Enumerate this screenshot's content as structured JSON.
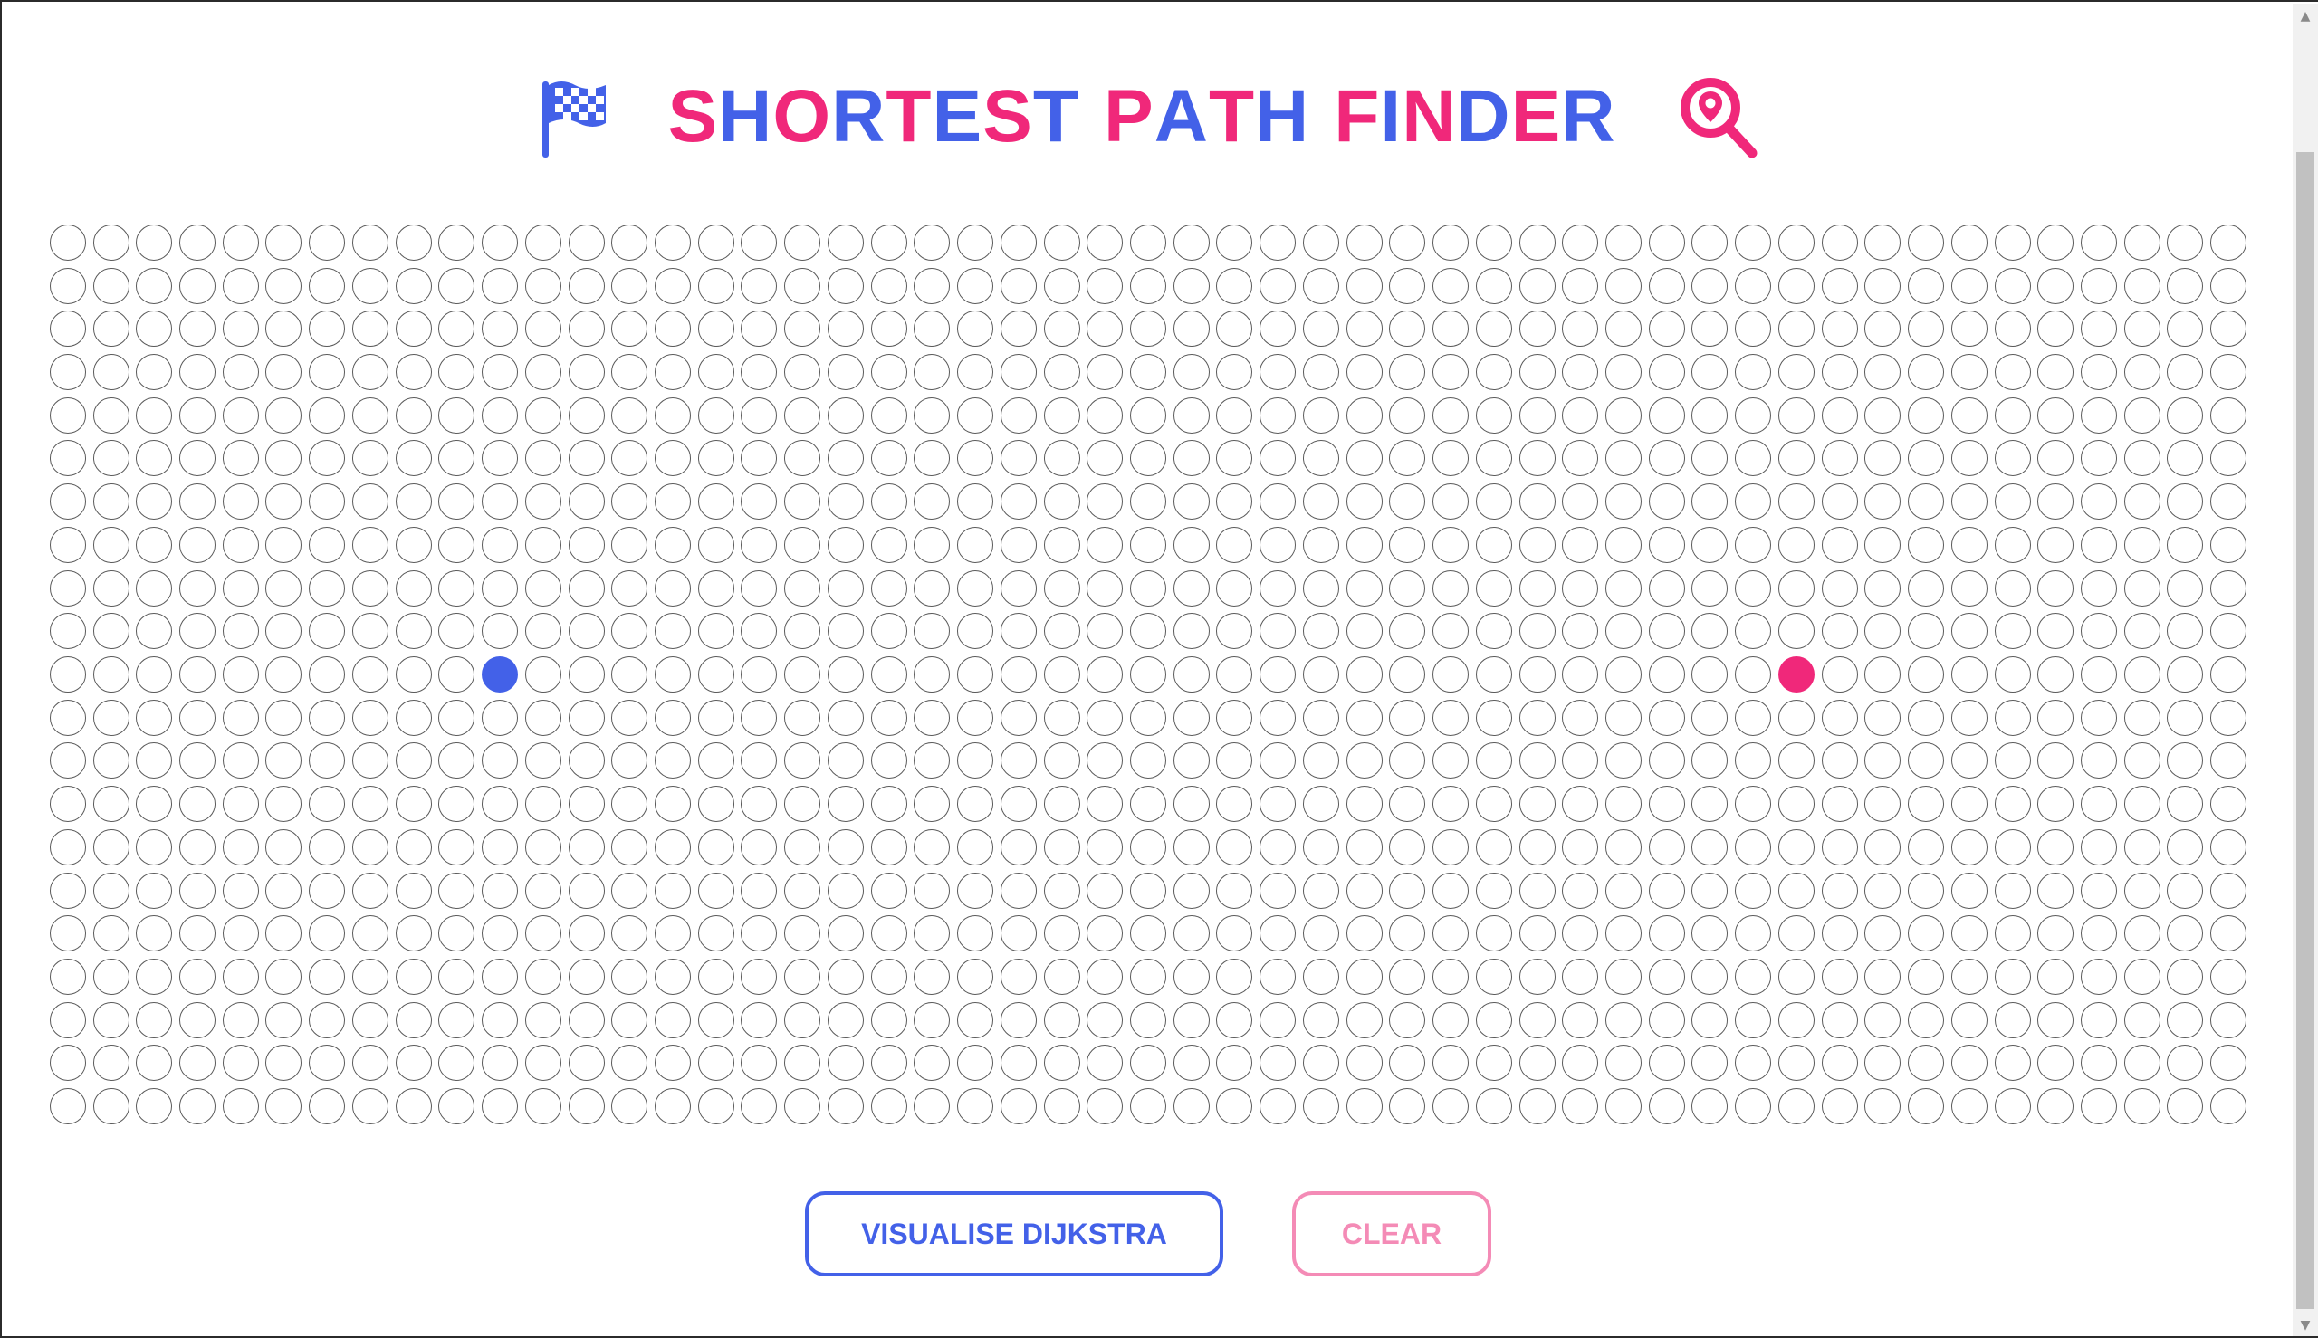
{
  "header": {
    "title_letters": [
      {
        "ch": "S",
        "color": "#f0287a"
      },
      {
        "ch": "H",
        "color": "#4361e8"
      },
      {
        "ch": "O",
        "color": "#f0287a"
      },
      {
        "ch": "R",
        "color": "#4361e8"
      },
      {
        "ch": "T",
        "color": "#f0287a"
      },
      {
        "ch": "E",
        "color": "#4361e8"
      },
      {
        "ch": "S",
        "color": "#f0287a"
      },
      {
        "ch": "T",
        "color": "#4361e8"
      },
      {
        "ch": " ",
        "color": "#ffffff"
      },
      {
        "ch": "P",
        "color": "#f0287a"
      },
      {
        "ch": "A",
        "color": "#4361e8"
      },
      {
        "ch": "T",
        "color": "#f0287a"
      },
      {
        "ch": "H",
        "color": "#4361e8"
      },
      {
        "ch": " ",
        "color": "#ffffff"
      },
      {
        "ch": "F",
        "color": "#f0287a"
      },
      {
        "ch": "I",
        "color": "#4361e8"
      },
      {
        "ch": "N",
        "color": "#f0287a"
      },
      {
        "ch": "D",
        "color": "#4361e8"
      },
      {
        "ch": "E",
        "color": "#f0287a"
      },
      {
        "ch": "R",
        "color": "#4361e8"
      }
    ],
    "left_icon": "checkered-flag-icon",
    "right_icon": "location-search-icon"
  },
  "grid": {
    "rows": 21,
    "cols": 51,
    "start_node": {
      "row": 10,
      "col": 10
    },
    "target_node": {
      "row": 10,
      "col": 40
    }
  },
  "buttons": {
    "visualise_label": "VISUALISE DIJKSTRA",
    "clear_label": "CLEAR"
  },
  "colors": {
    "blue": "#4361e8",
    "pink": "#f0287a",
    "pink_light": "#f48bb6"
  }
}
